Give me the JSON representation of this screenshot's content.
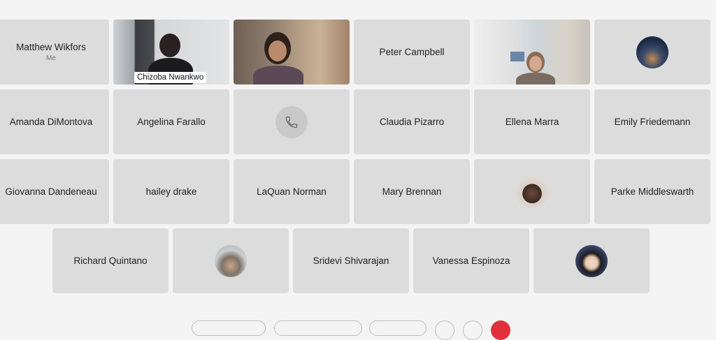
{
  "participants": {
    "matthew": {
      "name": "Matthew Wikfors",
      "sub": "Me"
    },
    "chizoba": {
      "name": "Chizoba Nwankwo"
    },
    "peter": {
      "name": "Peter Campbell"
    },
    "amanda": {
      "name": "Amanda DiMontova"
    },
    "angelina": {
      "name": "Angelina Farallo"
    },
    "claudia": {
      "name": "Claudia Pizarro"
    },
    "ellena": {
      "name": "Ellena Marra"
    },
    "emily": {
      "name": "Emily Friedemann"
    },
    "giovanna": {
      "name": "Giovanna Dandeneau"
    },
    "hailey": {
      "name": "hailey drake"
    },
    "laquan": {
      "name": "LaQuan Norman"
    },
    "mary": {
      "name": "Mary Brennan"
    },
    "parke": {
      "name": "Parke Middleswarth"
    },
    "richard": {
      "name": "Richard Quintano"
    },
    "sridevi": {
      "name": "Sridevi Shivarajan"
    },
    "vanessa": {
      "name": "Vanessa Espinoza"
    }
  },
  "colors": {
    "active_border": "#4fb6f0",
    "tile_bg": "#dcdcdc",
    "end_call": "#e0313a"
  },
  "icons": {
    "phone": "phone-icon"
  }
}
